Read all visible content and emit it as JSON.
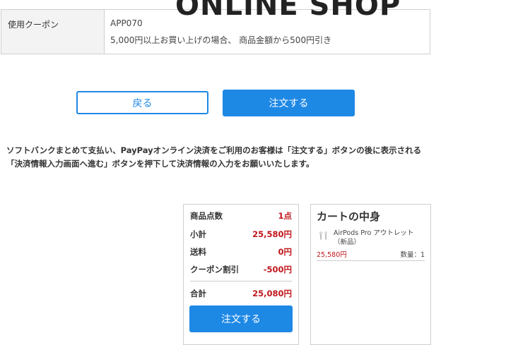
{
  "header": {
    "logo_text": "ONLINE SHOP"
  },
  "coupon": {
    "label": "使用クーポン",
    "code": "APP070",
    "description": "5,000円以上お買い上げの場合、 商品金額から500円引き"
  },
  "actions": {
    "back_label": "戻る",
    "order_label": "注文する"
  },
  "notice": {
    "line1": "ソフトバンクまとめて支払い、PayPayオンライン決済をご利用のお客様は「注文する」ボタンの後に表示される",
    "line2": "「決済情報入力画面へ進む」ボタンを押下して決済情報の入力をお願いいたします。"
  },
  "summary": {
    "rows": [
      {
        "label": "商品点数",
        "value": "1点"
      },
      {
        "label": "小計",
        "value": "25,580円"
      },
      {
        "label": "送料",
        "value": "0円"
      },
      {
        "label": "クーポン割引",
        "value": "-500円"
      }
    ],
    "total_label": "合計",
    "total_value": "25,080円",
    "order_label": "注文する"
  },
  "cart": {
    "title": "カートの中身",
    "items": [
      {
        "name": "AirPods Pro アウトレット（新品）",
        "price": "25,580円",
        "quantity": "数量：1",
        "icon": "earbuds-icon"
      }
    ]
  },
  "colors": {
    "accent": "#1e88e5",
    "price": "#c0161b"
  }
}
